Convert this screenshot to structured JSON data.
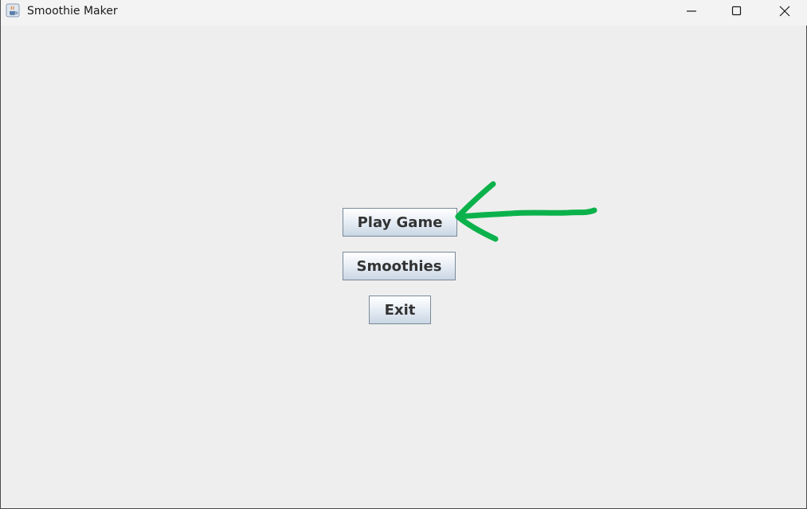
{
  "window": {
    "title": "Smoothie Maker",
    "app_icon": "java-cup-icon",
    "controls": {
      "minimize_icon": "minimize-icon",
      "maximize_icon": "maximize-icon",
      "close_icon": "close-icon"
    }
  },
  "menu": {
    "buttons": [
      {
        "label": "Play Game"
      },
      {
        "label": "Smoothies"
      },
      {
        "label": "Exit"
      }
    ]
  },
  "annotation": {
    "type": "hand-drawn-arrow",
    "points_to": "Play Game",
    "color": "#0bb24b"
  },
  "colors": {
    "window_background": "#eeeeee",
    "titlebar_background": "#f3f3f4",
    "button_text": "#333333",
    "button_border": "#7a8a99"
  }
}
